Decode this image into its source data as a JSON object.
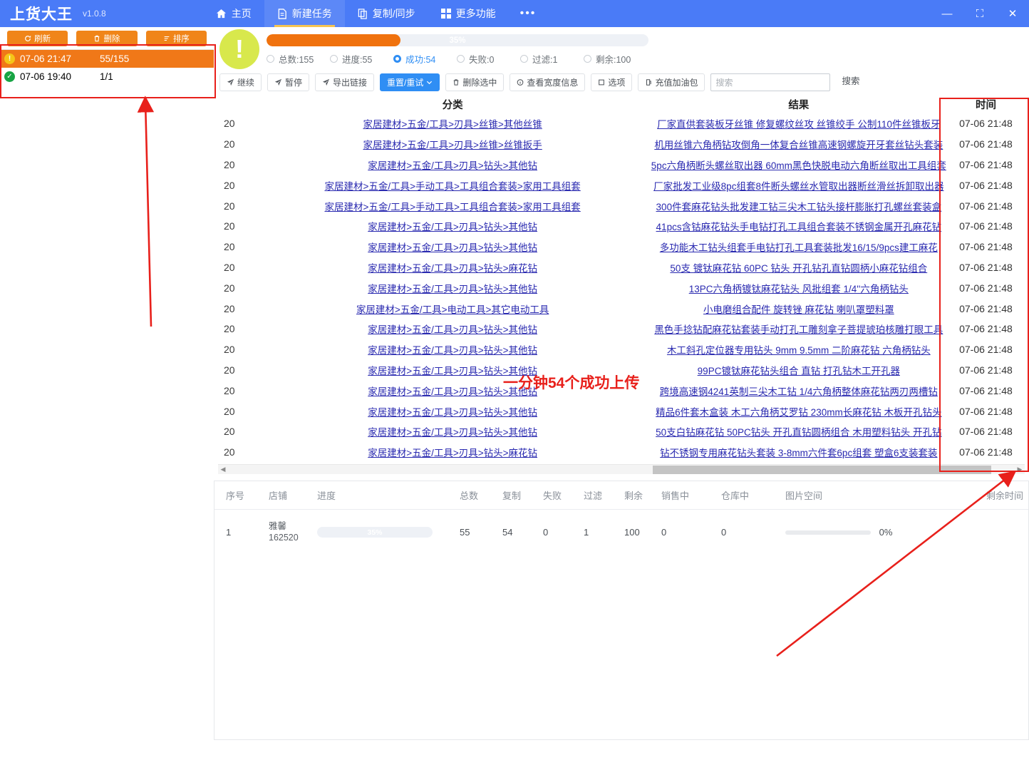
{
  "titlebar": {
    "brand": "上货大王",
    "version": "v1.0.8",
    "nav": [
      {
        "label": "主页",
        "icon": "home-icon",
        "active": false
      },
      {
        "label": "新建任务",
        "icon": "file-icon",
        "active": true
      },
      {
        "label": "复制/同步",
        "icon": "copy-icon",
        "active": false
      },
      {
        "label": "更多功能",
        "icon": "grid-icon",
        "active": false
      }
    ],
    "more_dots": "•••",
    "window": {
      "minimize": "—",
      "maximize": "⛶",
      "close": "✕"
    }
  },
  "left_panel": {
    "buttons": [
      {
        "label": "刷新",
        "icon": "refresh-icon"
      },
      {
        "label": "删除",
        "icon": "trash-icon"
      },
      {
        "label": "排序",
        "icon": "sort-icon"
      }
    ],
    "tasks": [
      {
        "status": "warning",
        "status_glyph": "!",
        "time": "07-06 21:47",
        "count": "55/155",
        "selected": true
      },
      {
        "status": "success",
        "status_glyph": "✓",
        "time": "07-06 19:40",
        "count": "1/1",
        "selected": false
      }
    ]
  },
  "status": {
    "warn_glyph": "!",
    "progress_percent": 35,
    "progress_label": "35%",
    "stats": [
      {
        "label": "总数:155",
        "active": false
      },
      {
        "label": "进度:55",
        "active": false
      },
      {
        "label": "成功:54",
        "active": true
      },
      {
        "label": "失败:0",
        "active": false
      },
      {
        "label": "过滤:1",
        "active": false
      },
      {
        "label": "剩余:100",
        "active": false
      }
    ]
  },
  "toolbar": {
    "buttons": [
      {
        "label": "继续",
        "icon": "play-icon",
        "primary": false,
        "caret": false
      },
      {
        "label": "暂停",
        "icon": "pause-icon",
        "primary": false,
        "caret": false
      },
      {
        "label": "导出链接",
        "icon": "export-icon",
        "primary": false,
        "caret": false
      },
      {
        "label": "重置/重试",
        "icon": "retry-icon",
        "primary": true,
        "caret": true
      },
      {
        "label": "删除选中",
        "icon": "trash-icon",
        "primary": false,
        "caret": false
      },
      {
        "label": "查看宽度信息",
        "icon": "info-icon",
        "primary": false,
        "caret": false
      },
      {
        "label": "选项",
        "icon": "options-icon",
        "primary": false,
        "caret": false
      },
      {
        "label": "充值加油包",
        "icon": "fuel-icon",
        "primary": false,
        "caret": false
      }
    ],
    "search_placeholder": "搜索",
    "search_value": "",
    "search_button": "搜索"
  },
  "grid": {
    "headers": {
      "num": "",
      "category": "分类",
      "result": "结果",
      "time": "时间"
    },
    "rows": [
      {
        "num": "20",
        "category": "家居建材>五金/工具>刃具>丝锥>其他丝锥",
        "result": "厂家直供套装板牙丝锥 修复螺纹丝攻 丝锥绞手 公制110件丝锥板牙",
        "time": "07-06 21:48"
      },
      {
        "num": "20",
        "category": "家居建材>五金/工具>刃具>丝锥>丝锥扳手",
        "result": "机用丝锥六角柄钻攻倒角一体复合丝锥高速钢螺旋开牙套丝钻头套装",
        "time": "07-06 21:48"
      },
      {
        "num": "20",
        "category": "家居建材>五金/工具>刃具>钻头>其他钻",
        "result": "5pc六角柄断头螺丝取出器 60mm黑色快脱电动六角断丝取出工具组套",
        "time": "07-06 21:48"
      },
      {
        "num": "20",
        "category": "家居建材>五金/工具>手动工具>工具组合套装>家用工具组套",
        "result": "厂家批发工业级8pc组套8件断头螺丝水管取出器断丝滑丝拆卸取出器",
        "time": "07-06 21:48"
      },
      {
        "num": "20",
        "category": "家居建材>五金/工具>手动工具>工具组合套装>家用工具组套",
        "result": "300件套麻花钻头批发建工钻三尖木工钻头接杆膨胀打孔螺丝套装盒",
        "time": "07-06 21:48"
      },
      {
        "num": "20",
        "category": "家居建材>五金/工具>刃具>钻头>其他钻",
        "result": "41pcs含钴麻花钻头手电钻打孔工具组合套装不锈钢金属开孔麻花钻",
        "time": "07-06 21:48"
      },
      {
        "num": "20",
        "category": "家居建材>五金/工具>刃具>钻头>其他钻",
        "result": "多功能木工钻头组套手电钻打孔工具套装批发16/15/9pcs建工麻花",
        "time": "07-06 21:48"
      },
      {
        "num": "20",
        "category": "家居建材>五金/工具>刃具>钻头>麻花钻",
        "result": "50支 镀钛麻花钻 60PC 钻头 开孔钻孔直钻圆柄小麻花钻组合",
        "time": "07-06 21:48"
      },
      {
        "num": "20",
        "category": "家居建材>五金/工具>刃具>钻头>其他钻",
        "result": "13PC六角柄镀钛麻花钻头 风批组套 1/4''六角柄钻头",
        "time": "07-06 21:48"
      },
      {
        "num": "20",
        "category": "家居建材>五金/工具>电动工具>其它电动工具",
        "result": "小电磨组合配件 旋转锉 麻花钻 喇叭罩塑料罩",
        "time": "07-06 21:48"
      },
      {
        "num": "20",
        "category": "家居建材>五金/工具>刃具>钻头>其他钻",
        "result": "黑色手捻钻配麻花钻套装手动打孔工雕刻拿子菩提琥珀核雕打眼工具",
        "time": "07-06 21:48"
      },
      {
        "num": "20",
        "category": "家居建材>五金/工具>刃具>钻头>其他钻",
        "result": "木工斜孔定位器专用钻头 9mm 9.5mm 二阶麻花钻 六角柄钻头",
        "time": "07-06 21:48"
      },
      {
        "num": "20",
        "category": "家居建材>五金/工具>刃具>钻头>其他钻",
        "result": "99PC镀钛麻花钻头组合 直钻 打孔钻木工开孔器",
        "time": "07-06 21:48"
      },
      {
        "num": "20",
        "category": "家居建材>五金/工具>刃具>钻头>其他钻",
        "result": "跨境高速钢4241英制三尖木工钻 1/4六角柄整体麻花钻两刃两槽钻",
        "time": "07-06 21:48"
      },
      {
        "num": "20",
        "category": "家居建材>五金/工具>刃具>钻头>其他钻",
        "result": "精品6件套木盒装 木工六角柄艾罗钻 230mm长麻花钻 木板开孔钻头",
        "time": "07-06 21:48"
      },
      {
        "num": "20",
        "category": "家居建材>五金/工具>刃具>钻头>其他钻",
        "result": "50支白钻麻花钻 50PC钻头 开孔直钻圆柄组合 木用塑料钻头 开孔钻",
        "time": "07-06 21:48"
      },
      {
        "num": "20",
        "category": "家居建材>五金/工具>刃具>钻头>麻花钻",
        "result": "钻不锈钢专用麻花钻头套装 3-8mm六件套6pc组套 塑盒6支装套装",
        "time": "07-06 21:48"
      }
    ]
  },
  "bottom_grid": {
    "headers": [
      "序号",
      "店铺",
      "进度",
      "总数",
      "复制",
      "失败",
      "过滤",
      "剩余",
      "销售中",
      "仓库中",
      "图片空间",
      "剩余时间"
    ],
    "rows": [
      {
        "index": "1",
        "shop_name": "雅馨",
        "shop_id": "162520",
        "progress_percent": 35,
        "progress_label": "35%",
        "total": "55",
        "copy": "54",
        "fail": "0",
        "filter": "1",
        "remain": "100",
        "selling": "0",
        "stock": "0",
        "image_space_percent": 0,
        "image_space_label": "0%",
        "remain_time": ""
      }
    ]
  },
  "annotations": {
    "red_note": "一分钟54个成功上传",
    "accent_red": "#e8201b"
  }
}
